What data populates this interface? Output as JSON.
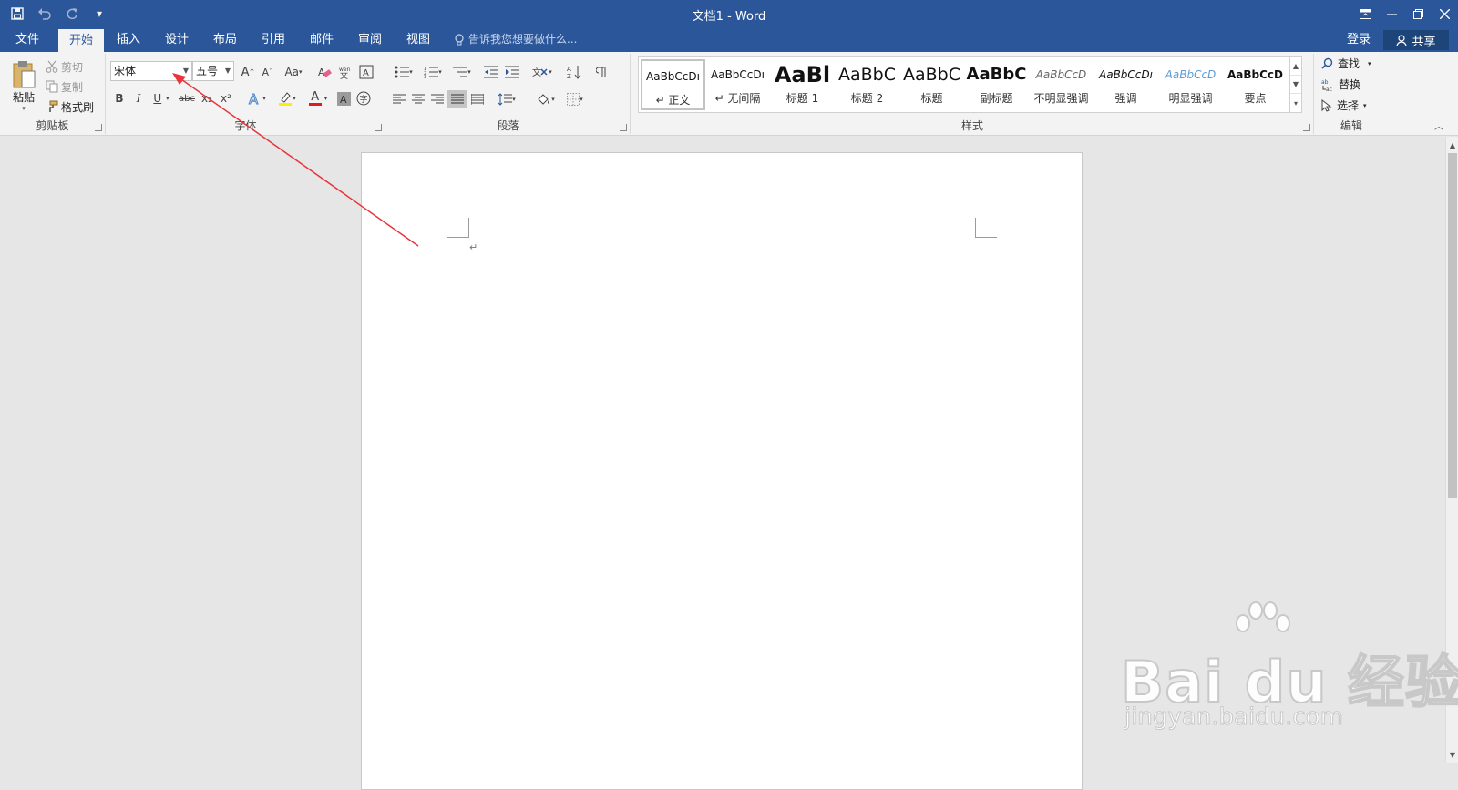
{
  "window": {
    "title": "文档1 - Word",
    "qat_more": "▾"
  },
  "tabs": [
    {
      "label": "文件"
    },
    {
      "label": "开始",
      "active": true
    },
    {
      "label": "插入"
    },
    {
      "label": "设计"
    },
    {
      "label": "布局"
    },
    {
      "label": "引用"
    },
    {
      "label": "邮件"
    },
    {
      "label": "审阅"
    },
    {
      "label": "视图"
    }
  ],
  "tell_me": "告诉我您想要做什么...",
  "account": {
    "login": "登录",
    "share": "共享"
  },
  "clipboard": {
    "paste": "粘贴",
    "cut": "剪切",
    "copy": "复制",
    "format_painter": "格式刷",
    "label": "剪贴板"
  },
  "font": {
    "name": "宋体",
    "size": "五号",
    "grow": "A",
    "shrink": "A",
    "case": "Aa",
    "bold": "B",
    "italic": "I",
    "underline": "U",
    "strike": "abc",
    "sub": "x₂",
    "sup": "x²",
    "color_letter": "A",
    "label": "字体"
  },
  "paragraph": {
    "label": "段落"
  },
  "styles": {
    "label": "样式",
    "items": [
      {
        "sample": "AaBbCcDı",
        "name": "↵ 正文",
        "selected": true
      },
      {
        "sample": "AaBbCcDı",
        "name": "↵ 无间隔"
      },
      {
        "sample": "AaBl",
        "name": "标题 1"
      },
      {
        "sample": "AaBbC",
        "name": "标题 2"
      },
      {
        "sample": "AaBbC",
        "name": "标题"
      },
      {
        "sample": "AaBbC",
        "name": "副标题"
      },
      {
        "sample": "AaBbCcD",
        "name": "不明显强调"
      },
      {
        "sample": "AaBbCcDı",
        "name": "强调"
      },
      {
        "sample": "AaBbCcD",
        "name": "明显强调"
      },
      {
        "sample": "AaBbCcD",
        "name": "要点"
      }
    ]
  },
  "editing": {
    "find": "查找",
    "replace": "替换",
    "select": "选择",
    "label": "编辑"
  },
  "document": {
    "paragraph_mark": "↵"
  },
  "watermark": {
    "brand": "Bai du 经验",
    "url": "jingyan.baidu.com"
  },
  "colors": {
    "title_bar": "#2b579a",
    "ribbon": "#f3f3f3",
    "annotation_arrow": "#e8343a"
  }
}
